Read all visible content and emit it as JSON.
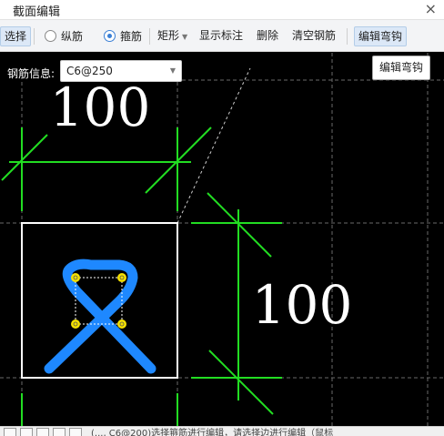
{
  "window": {
    "title": "截面编辑",
    "close_glyph": "×"
  },
  "toolbar": {
    "select": "选择",
    "longitudinal": "纵筋",
    "stirrup": "箍筋",
    "shape": "矩形",
    "show_annotation": "显示标注",
    "delete": "删除",
    "clear_rebar": "清空钢筋",
    "edit_hook": "编辑弯钩",
    "selected_radio": "stirrup"
  },
  "rebar_info": {
    "label": "钢筋信息:",
    "value": "C6@250"
  },
  "tooltip": "编辑弯钩",
  "dimensions": {
    "top": "100",
    "right": "100"
  },
  "status": {
    "text": "(..., C6@200)选择箍筋进行编辑，请选择边进行编辑（鼠标"
  },
  "colors": {
    "canvas_bg": "#000000",
    "dimension_line": "#22dd22",
    "section_border": "#ffffff",
    "stirrup": "#1e88ff",
    "rebar_point": "#f5e100",
    "grid": "#666666"
  }
}
